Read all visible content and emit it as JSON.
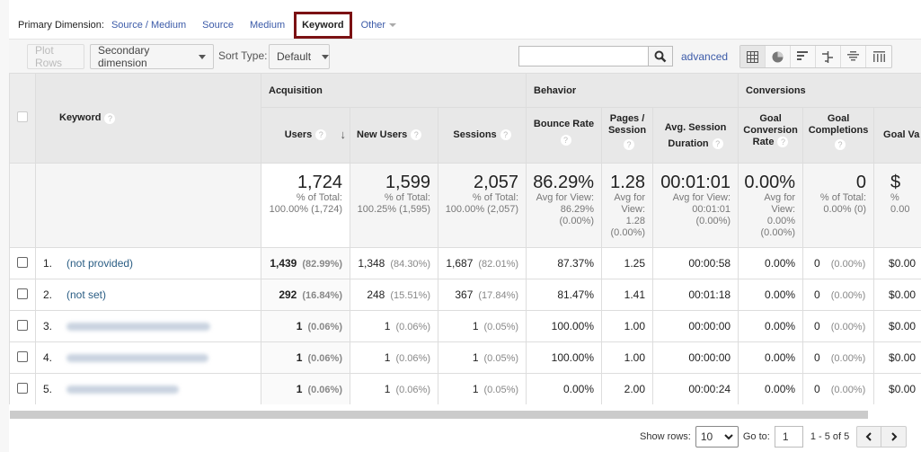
{
  "primary_dimension": {
    "label": "Primary Dimension:",
    "options": [
      "Source / Medium",
      "Source",
      "Medium",
      "Keyword"
    ],
    "active": "Keyword",
    "other_label": "Other"
  },
  "toolbar": {
    "plot_rows": "Plot Rows",
    "secondary_dimension": "Secondary dimension",
    "sort_type_label": "Sort Type:",
    "sort_type_value": "Default",
    "search_value": "",
    "advanced": "advanced",
    "views": [
      "table-view",
      "pie-view",
      "performance-view",
      "comparison-view",
      "term-cloud-view",
      "pivot-view"
    ]
  },
  "table": {
    "dimension_header": "Keyword",
    "groups": [
      "Acquisition",
      "Behavior",
      "Conversions"
    ],
    "columns": [
      "Users",
      "New Users",
      "Sessions",
      "Bounce Rate",
      "Pages / Session",
      "Avg. Session Duration",
      "Goal Conversion Rate",
      "Goal Completions",
      "Goal Va"
    ],
    "sort_column": "Users",
    "totals": [
      {
        "value": "1,724",
        "l1": "% of Total:",
        "l2": "100.00% (1,724)"
      },
      {
        "value": "1,599",
        "l1": "% of Total:",
        "l2": "100.25% (1,595)"
      },
      {
        "value": "2,057",
        "l1": "% of Total:",
        "l2": "100.00% (2,057)"
      },
      {
        "value": "86.29%",
        "l1": "Avg for View:",
        "l2": "86.29%",
        "l3": "(0.00%)"
      },
      {
        "value": "1.28",
        "l1": "Avg for",
        "l2": "View:",
        "l3": "1.28",
        "l4": "(0.00%)"
      },
      {
        "value": "00:01:01",
        "l1": "Avg for View:",
        "l2": "00:01:01",
        "l3": "(0.00%)"
      },
      {
        "value": "0.00%",
        "l1": "Avg for",
        "l2": "View:",
        "l3": "0.00%",
        "l4": "(0.00%)"
      },
      {
        "value": "0",
        "l1": "% of Total:",
        "l2": "0.00% (0)"
      },
      {
        "value": "$",
        "l1": "%",
        "l2": "0.00"
      }
    ],
    "rows": [
      {
        "rank": "1.",
        "keyword": "(not provided)",
        "blurred": false,
        "users": "1,439",
        "users_pct": "(82.99%)",
        "new_users": "1,348",
        "new_users_pct": "(84.30%)",
        "sessions": "1,687",
        "sessions_pct": "(82.01%)",
        "bounce": "87.37%",
        "pps": "1.25",
        "duration": "00:00:58",
        "conv_rate": "0.00%",
        "completions": "0",
        "completions_pct": "(0.00%)",
        "value": "$0.00"
      },
      {
        "rank": "2.",
        "keyword": "(not set)",
        "blurred": false,
        "users": "292",
        "users_pct": "(16.84%)",
        "new_users": "248",
        "new_users_pct": "(15.51%)",
        "sessions": "367",
        "sessions_pct": "(17.84%)",
        "bounce": "81.47%",
        "pps": "1.41",
        "duration": "00:01:18",
        "conv_rate": "0.00%",
        "completions": "0",
        "completions_pct": "(0.00%)",
        "value": "$0.00"
      },
      {
        "rank": "3.",
        "keyword": "",
        "blurred": true,
        "users": "1",
        "users_pct": "(0.06%)",
        "new_users": "1",
        "new_users_pct": "(0.06%)",
        "sessions": "1",
        "sessions_pct": "(0.05%)",
        "bounce": "100.00%",
        "pps": "1.00",
        "duration": "00:00:00",
        "conv_rate": "0.00%",
        "completions": "0",
        "completions_pct": "(0.00%)",
        "value": "$0.00"
      },
      {
        "rank": "4.",
        "keyword": "",
        "blurred": true,
        "users": "1",
        "users_pct": "(0.06%)",
        "new_users": "1",
        "new_users_pct": "(0.06%)",
        "sessions": "1",
        "sessions_pct": "(0.05%)",
        "bounce": "100.00%",
        "pps": "1.00",
        "duration": "00:00:00",
        "conv_rate": "0.00%",
        "completions": "0",
        "completions_pct": "(0.00%)",
        "value": "$0.00"
      },
      {
        "rank": "5.",
        "keyword": "",
        "blurred": true,
        "users": "1",
        "users_pct": "(0.06%)",
        "new_users": "1",
        "new_users_pct": "(0.06%)",
        "sessions": "1",
        "sessions_pct": "(0.05%)",
        "bounce": "0.00%",
        "pps": "2.00",
        "duration": "00:00:24",
        "conv_rate": "0.00%",
        "completions": "0",
        "completions_pct": "(0.00%)",
        "value": "$0.00"
      }
    ]
  },
  "pagination": {
    "show_rows_label": "Show rows:",
    "show_rows_value": "10",
    "goto_label": "Go to:",
    "goto_value": "1",
    "range": "1 - 5 of 5"
  },
  "colors": {
    "link": "#3b5aa8",
    "active_border": "#7b1113",
    "keyword_link": "#2a5d84"
  }
}
